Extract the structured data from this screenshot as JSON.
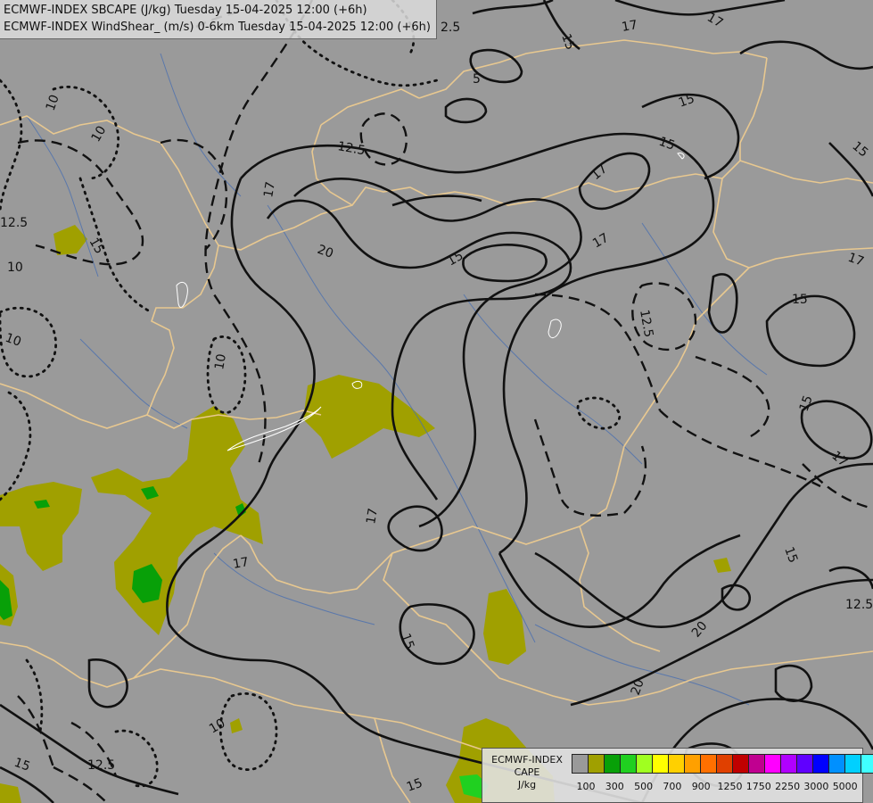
{
  "header": {
    "line1": "ECMWF-INDEX SBCAPE (J/kg) Tuesday 15-04-2025 12:00 (+6h)",
    "line2": "ECMWF-INDEX WindShear_ (m/s) 0-6km Tuesday 15-04-2025 12:00 (+6h)"
  },
  "legend": {
    "line1": "ECMWF-INDEX",
    "line2": "CAPE",
    "unit": "J/kg",
    "colors": [
      "#9a9a9a",
      "#a0a000",
      "#08a008",
      "#20d020",
      "#a0ff20",
      "#ffff00",
      "#ffd000",
      "#ffa000",
      "#ff7000",
      "#e04000",
      "#c00000",
      "#c00090",
      "#ff00ff",
      "#b000ff",
      "#6000ff",
      "#0000ff",
      "#0090ff",
      "#00d0ff",
      "#40ffff",
      "#ffffff"
    ],
    "ticks": [
      "100",
      "300",
      "500",
      "700",
      "900",
      "1250",
      "1750",
      "2250",
      "3000",
      "5000"
    ]
  },
  "contour_labels": [
    "2.5",
    "15",
    "17",
    "17",
    "15",
    "5",
    "15",
    "12.5",
    "15",
    "17",
    "20",
    "15",
    "17",
    "17",
    "12.5",
    "15",
    "10",
    "17",
    "10",
    "15",
    "12.5",
    "10",
    "10",
    "10",
    "17",
    "15",
    "17",
    "15",
    "17",
    "15",
    "20",
    "12.5",
    "20",
    "10",
    "12.5",
    "15",
    "15"
  ]
}
